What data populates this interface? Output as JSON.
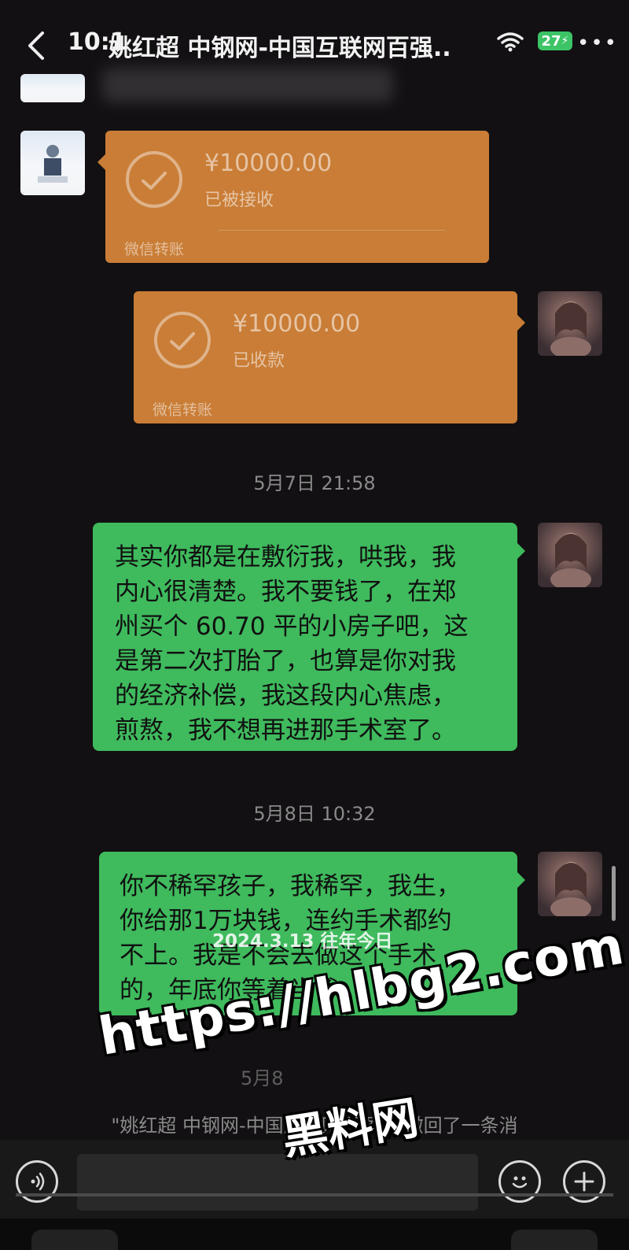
{
  "header": {
    "time": "10:1",
    "title": "姚红超 中钢网-中国互联网百强..",
    "battery": "27"
  },
  "messages": {
    "transfer_received": {
      "amount": "¥10000.00",
      "status": "已被接收",
      "footer": "微信转账"
    },
    "transfer_collected": {
      "amount": "¥10000.00",
      "status": "已收款",
      "footer": "微信转账"
    },
    "timestamp_1": "5月7日 21:58",
    "bubble_1": {
      "lines": [
        "其实你都是在敷衍我，哄我，我",
        "内心很清楚。我不要钱了，在郑",
        "州买个 60.70 平的小房子吧，这",
        "是第二次打胎了，也算是你对我",
        "的经济补偿，我这段内心焦虑，",
        "煎熬，我不想再进那手术室了。"
      ]
    },
    "timestamp_2": "5月8日 10:32",
    "bubble_2": {
      "lines": [
        "你不稀罕孩子，我稀罕，我生，",
        "你给那1万块钱，连约手术都约",
        "不上。我是不会去做这个手术",
        "的，年底你等着当爹。"
      ]
    },
    "timestamp_3": "5月8",
    "recall_notice": "\"姚红超 中钢网-中国互联网百强..\" 撤回了一条消"
  },
  "overlays": {
    "date_watermark": "2024.3.13 往年今日",
    "site_url": "https://hlbg2.com",
    "site_name": "黑料网"
  },
  "icons": {
    "back": "chevron-left-icon",
    "wifi": "wifi-icon",
    "battery": "battery-icon",
    "voice": "voice-icon",
    "emoji": "emoji-icon",
    "plus": "plus-icon"
  },
  "colors": {
    "transfer": "#c97d36",
    "bubble_green": "#3fba5d",
    "background": "#121012"
  }
}
